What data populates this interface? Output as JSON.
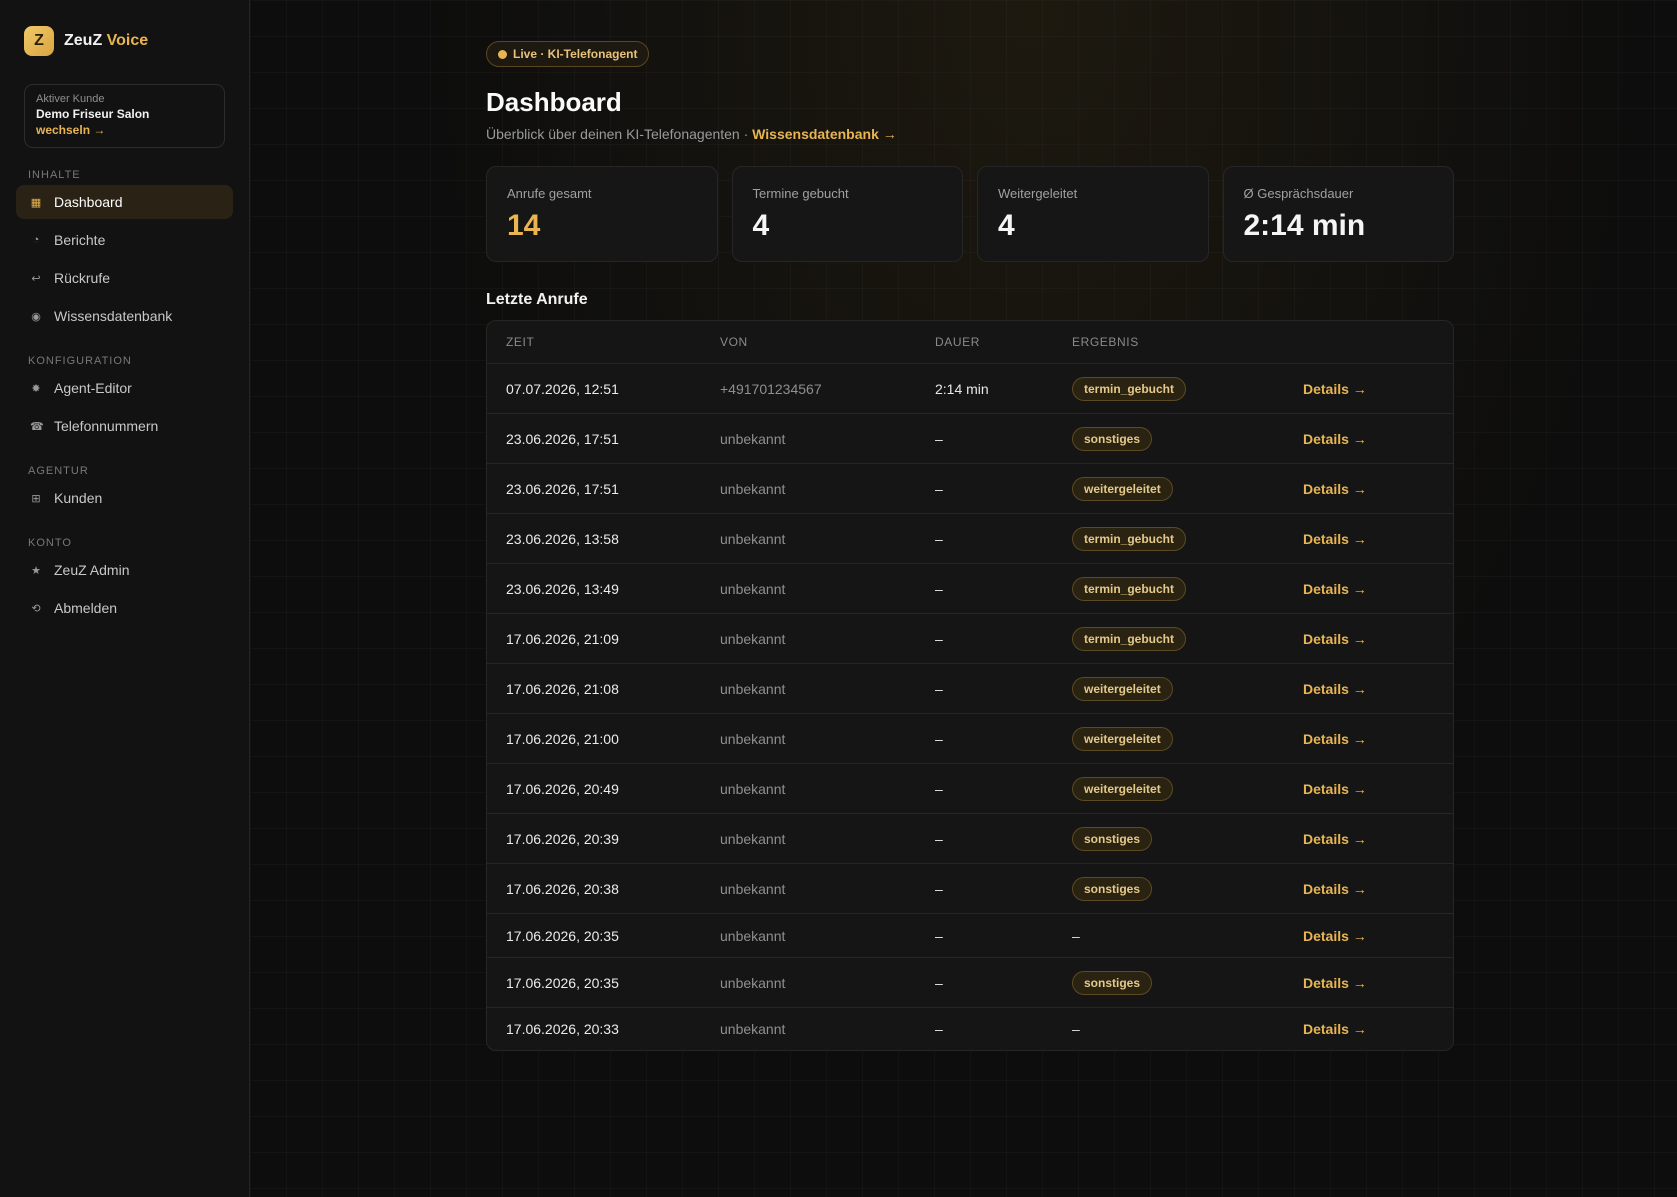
{
  "brand": {
    "logo_letter": "Z",
    "name": "ZeuZ",
    "accent": "Voice"
  },
  "client": {
    "label": "Aktiver Kunde",
    "name": "Demo Friseur Salon",
    "switch_label": "wechseln →"
  },
  "sidebar": {
    "sections": [
      {
        "title": "INHALTE",
        "items": [
          {
            "label": "Dashboard",
            "icon": "grid-icon",
            "glyph": "▦",
            "active": true
          },
          {
            "label": "Berichte",
            "icon": "pie-chart-icon",
            "glyph": "◔",
            "active": false
          },
          {
            "label": "Rückrufe",
            "icon": "return-arrow-icon",
            "glyph": "↩",
            "active": false
          },
          {
            "label": "Wissensdatenbank",
            "icon": "circle-dot-icon",
            "glyph": "◉",
            "active": false
          }
        ]
      },
      {
        "title": "KONFIGURATION",
        "items": [
          {
            "label": "Agent-Editor",
            "icon": "sparkle-icon",
            "glyph": "✸",
            "active": false
          },
          {
            "label": "Telefonnummern",
            "icon": "phone-icon",
            "glyph": "☎",
            "active": false
          }
        ]
      },
      {
        "title": "AGENTUR",
        "items": [
          {
            "label": "Kunden",
            "icon": "squares-icon",
            "glyph": "⊞",
            "active": false
          }
        ]
      },
      {
        "title": "KONTO",
        "items": [
          {
            "label": "ZeuZ Admin",
            "icon": "star-icon",
            "glyph": "★",
            "active": false
          },
          {
            "label": "Abmelden",
            "icon": "logout-icon",
            "glyph": "⟲",
            "active": false
          }
        ]
      }
    ]
  },
  "header": {
    "badge": "Live · KI-Telefonagent",
    "title": "Dashboard",
    "subtitle": "Überblick über deinen KI-Telefonagenten ·",
    "subtitle_link": "Wissensdatenbank →"
  },
  "stats": [
    {
      "label": "Anrufe gesamt",
      "value": "14",
      "accent": true
    },
    {
      "label": "Termine gebucht",
      "value": "4",
      "accent": false
    },
    {
      "label": "Weitergeleitet",
      "value": "4",
      "accent": false
    },
    {
      "label": "Ø Gesprächsdauer",
      "value": "2:14 min",
      "accent": false
    }
  ],
  "calls": {
    "title": "Letzte Anrufe",
    "columns": [
      "ZEIT",
      "VON",
      "DAUER",
      "ERGEBNIS"
    ],
    "details_label": "Details →",
    "rows": [
      {
        "time": "07.07.2026, 12:51",
        "from": "+491701234567",
        "duration": "2:14 min",
        "result": "termin_gebucht"
      },
      {
        "time": "23.06.2026, 17:51",
        "from": "unbekannt",
        "duration": "–",
        "result": "sonstiges"
      },
      {
        "time": "23.06.2026, 17:51",
        "from": "unbekannt",
        "duration": "–",
        "result": "weitergeleitet"
      },
      {
        "time": "23.06.2026, 13:58",
        "from": "unbekannt",
        "duration": "–",
        "result": "termin_gebucht"
      },
      {
        "time": "23.06.2026, 13:49",
        "from": "unbekannt",
        "duration": "–",
        "result": "termin_gebucht"
      },
      {
        "time": "17.06.2026, 21:09",
        "from": "unbekannt",
        "duration": "–",
        "result": "termin_gebucht"
      },
      {
        "time": "17.06.2026, 21:08",
        "from": "unbekannt",
        "duration": "–",
        "result": "weitergeleitet"
      },
      {
        "time": "17.06.2026, 21:00",
        "from": "unbekannt",
        "duration": "–",
        "result": "weitergeleitet"
      },
      {
        "time": "17.06.2026, 20:49",
        "from": "unbekannt",
        "duration": "–",
        "result": "weitergeleitet"
      },
      {
        "time": "17.06.2026, 20:39",
        "from": "unbekannt",
        "duration": "–",
        "result": "sonstiges"
      },
      {
        "time": "17.06.2026, 20:38",
        "from": "unbekannt",
        "duration": "–",
        "result": "sonstiges"
      },
      {
        "time": "17.06.2026, 20:35",
        "from": "unbekannt",
        "duration": "–",
        "result": null
      },
      {
        "time": "17.06.2026, 20:35",
        "from": "unbekannt",
        "duration": "–",
        "result": "sonstiges"
      },
      {
        "time": "17.06.2026, 20:33",
        "from": "unbekannt",
        "duration": "–",
        "result": null
      }
    ]
  },
  "colors": {
    "accent": "#e8b552",
    "background": "#0d0d0d",
    "card": "#161616"
  }
}
